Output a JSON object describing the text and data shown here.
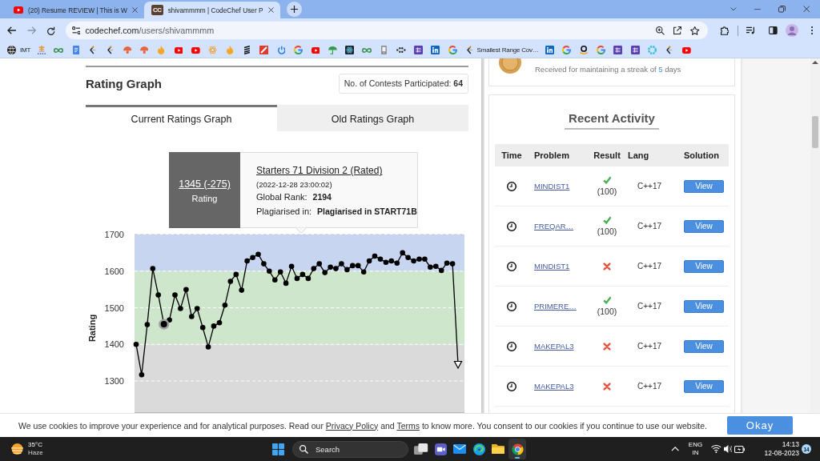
{
  "browser": {
    "tabs": [
      {
        "kind": "video",
        "title": "(20) Resume REVIEW | This is W",
        "selected": false
      },
      {
        "kind": "logo",
        "icon_text": "CC",
        "title": "shivammmm | CodeChef User P",
        "selected": true
      }
    ],
    "forward": {
      "disabled": true
    },
    "address": {
      "host": "codechef.com",
      "path": "/users/shivammmm"
    },
    "bookmarks": [
      {
        "kind": "globe",
        "label": "IMT"
      },
      {
        "kind": "glyph"
      },
      {
        "kind": "loop"
      },
      {
        "kind": "doc"
      },
      {
        "kind": "bracket"
      },
      {
        "kind": "bracket"
      },
      {
        "kind": "blob"
      },
      {
        "kind": "blob"
      },
      {
        "kind": "flame"
      },
      {
        "kind": "play"
      },
      {
        "kind": "play"
      },
      {
        "kind": "flower"
      },
      {
        "kind": "flame"
      },
      {
        "kind": "stripes"
      },
      {
        "kind": "square"
      },
      {
        "kind": "power"
      },
      {
        "kind": "g"
      },
      {
        "kind": "play"
      },
      {
        "kind": "umbrella"
      },
      {
        "kind": "atom"
      },
      {
        "kind": "loop"
      },
      {
        "kind": "page"
      },
      {
        "kind": "dots"
      },
      {
        "kind": "grid"
      },
      {
        "kind": "tile"
      },
      {
        "kind": "g"
      },
      {
        "kind": "bracket",
        "label": "Smallest Range Cov…"
      },
      {
        "kind": "tile"
      },
      {
        "kind": "g"
      },
      {
        "kind": "smile"
      },
      {
        "kind": "g"
      },
      {
        "kind": "grid"
      },
      {
        "kind": "grid"
      },
      {
        "kind": "ring"
      },
      {
        "kind": "bracket"
      },
      {
        "kind": "play"
      }
    ]
  },
  "rating_graph": {
    "title": "Rating Graph",
    "contests": {
      "label": "No. of Contests Participated:",
      "value": "64"
    },
    "tabs": [
      {
        "label": "Current Ratings Graph",
        "selected": true
      },
      {
        "label": "Old Ratings Graph",
        "selected": false
      }
    ],
    "tooltip": {
      "rating": "1345 (-275)",
      "rating_label": "Rating",
      "contest": "Starters 71 Division 2 (Rated)",
      "date": "(2022-12-28 23:00:02)",
      "rank_label": "Global Rank:",
      "rank": "2194",
      "plagiarism_label": "Plagiarised in:",
      "plagiarism": "Plagiarised in START71B"
    },
    "chart_data": {
      "type": "line",
      "ylabel": "Rating",
      "ylim": [
        1215,
        1700
      ],
      "yticks": [
        1300,
        1400,
        1500,
        1600,
        1700
      ],
      "grid": true,
      "series": [
        {
          "color": "#000000",
          "marker": "circle",
          "values": [
            1400,
            1317,
            1454,
            1607,
            1535,
            1455,
            1467,
            1535,
            1498,
            1550,
            1476,
            1498,
            1446,
            1393,
            1450,
            1459,
            1507,
            1572,
            1591,
            1548,
            1628,
            1637,
            1646,
            1620,
            1600,
            1576,
            1598,
            1567,
            1613,
            1580,
            1591,
            1580,
            1607,
            1620,
            1596,
            1611,
            1607,
            1620,
            1604,
            1615,
            1615,
            1598,
            1628,
            1641,
            1633,
            1624,
            1628,
            1622,
            1650,
            1637,
            1628,
            1633,
            1633,
            1611,
            1613,
            1602,
            1622,
            1620,
            1345
          ]
        },
        {
          "color": "#000000",
          "marker": "circle",
          "values": [
            null,
            null,
            null,
            null,
            null,
            1455,
            null,
            null,
            null,
            null,
            null,
            null,
            null,
            null,
            null,
            null,
            null,
            null,
            null,
            null,
            null,
            null,
            null,
            null,
            null,
            null,
            null,
            null,
            null,
            null,
            null,
            null,
            null,
            null,
            null,
            null,
            null,
            null,
            null,
            null,
            null,
            null,
            null,
            null,
            null,
            null,
            null,
            null,
            null,
            null,
            null,
            null,
            null,
            null,
            null,
            null,
            null,
            null,
            null
          ]
        },
        {
          "color": "#000000",
          "marker": "triangle",
          "values": [
            null,
            null,
            null,
            null,
            null,
            null,
            null,
            null,
            null,
            null,
            null,
            null,
            null,
            null,
            null,
            null,
            null,
            null,
            null,
            null,
            null,
            null,
            null,
            null,
            null,
            null,
            null,
            null,
            null,
            null,
            null,
            null,
            null,
            null,
            null,
            null,
            null,
            null,
            null,
            null,
            null,
            null,
            null,
            null,
            null,
            null,
            null,
            null,
            null,
            null,
            null,
            null,
            null,
            null,
            null,
            null,
            null,
            null,
            1345
          ]
        }
      ],
      "bands": [
        {
          "axis": "y",
          "from": 1600,
          "to": 1700,
          "color": "#c8d5f0"
        },
        {
          "axis": "y",
          "from": 1400,
          "to": 1600,
          "color": "#cde6cc"
        },
        {
          "axis": "y",
          "from": 1215,
          "to": 1400,
          "color": "#dadada"
        }
      ]
    }
  },
  "badge_card": {
    "description": {
      "before": "Received for maintaining a streak of ",
      "count": "5",
      "after": " days"
    }
  },
  "recent_activity": {
    "title": "Recent Activity",
    "columns": [
      "Time",
      "Problem",
      "Result",
      "Lang",
      "Solution"
    ],
    "rows": [
      {
        "problem": "MINDIST1",
        "result": {
          "kind": "accepted",
          "score": "(100)"
        },
        "lang": "C++17",
        "solution": "View"
      },
      {
        "problem": "FREQAR…",
        "result": {
          "kind": "accepted",
          "score": "(100)"
        },
        "lang": "C++17",
        "solution": "View"
      },
      {
        "problem": "MINDIST1",
        "result": {
          "kind": "rejected"
        },
        "lang": "C++17",
        "solution": "View"
      },
      {
        "problem": "PRIMERE…",
        "result": {
          "kind": "accepted",
          "score": "(100)"
        },
        "lang": "C++17",
        "solution": "View"
      },
      {
        "problem": "MAKEPAL3",
        "result": {
          "kind": "rejected"
        },
        "lang": "C++17",
        "solution": "View"
      },
      {
        "problem": "MAKEPAL3",
        "result": {
          "kind": "rejected"
        },
        "lang": "C++17",
        "solution": "View"
      }
    ]
  },
  "cookie_banner": {
    "segments": [
      {
        "kind": "text",
        "text": "We use cookies to improve your experience and for analytical purposes. Read our "
      },
      {
        "kind": "link",
        "text": "Privacy Policy"
      },
      {
        "kind": "text",
        "text": " and "
      },
      {
        "kind": "link",
        "text": "Terms"
      },
      {
        "kind": "text",
        "text": " to know more. You consent to our cookies if you continue to use our website."
      }
    ],
    "button": "Okay"
  },
  "taskbar": {
    "weather": {
      "temperature": "35°C",
      "condition": "Haze"
    },
    "search": {
      "placeholder": "Search"
    },
    "apps": [
      {
        "kind": "task_view",
        "active": false
      },
      {
        "kind": "meet",
        "active": false
      },
      {
        "kind": "mail",
        "active": false
      },
      {
        "kind": "edge",
        "active": false
      },
      {
        "kind": "files",
        "active": false
      },
      {
        "kind": "chrome",
        "active": true
      }
    ],
    "language": "ENG",
    "region": "IN",
    "time": "14:13",
    "date": "12-08-2023",
    "notifications": "14"
  }
}
